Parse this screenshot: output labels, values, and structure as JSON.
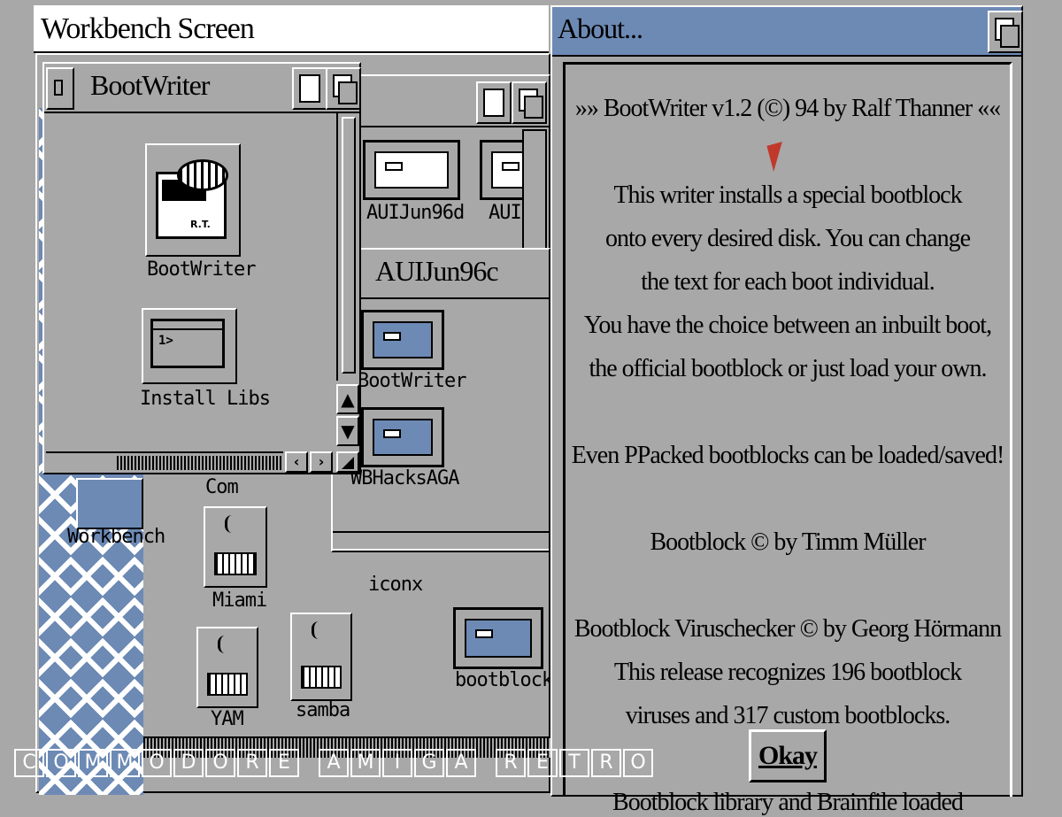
{
  "screen": {
    "title": "Workbench Screen"
  },
  "windows": {
    "bootwriter": {
      "title": "BootWriter",
      "icons": [
        {
          "label": "BootWriter",
          "badge": "R.T."
        },
        {
          "label": "Install Libs",
          "prompt": "1>"
        }
      ]
    },
    "back_drawer": {
      "icons": [
        "AUIJun96d",
        "AUI"
      ]
    },
    "auijun96c": {
      "title": "AUIJun96c",
      "icons": [
        "BootWriter",
        "WBHacksAGA",
        "iconx"
      ]
    },
    "workbench": {
      "icons": [
        "Workbench",
        "Miami",
        "YAM",
        "samba",
        "bootblock"
      ],
      "partial_label": "Com"
    }
  },
  "about": {
    "title": "About...",
    "lines": [
      "»» BootWriter v1.2 (©) 94 by Ralf Thanner ««",
      "This writer installs a special bootblock",
      "onto every desired disk.  You can change",
      "the text for each boot individual.",
      "You have the choice between an inbuilt boot,",
      "the official bootblock or just load your own.",
      "Even PPacked bootblocks can be loaded/saved!",
      "Bootblock  © by Timm Müller",
      "Bootblock Viruschecker  © by Georg Hörmann",
      "This release recognizes 196 bootblock",
      "viruses and 317 custom bootblocks.",
      "Bootblock library and Brainfile loaded"
    ],
    "okay": "Okay"
  },
  "watermark": [
    "C",
    "O",
    "M",
    "M",
    "O",
    "D",
    "O",
    "R",
    "E",
    " ",
    "A",
    "M",
    "I",
    "G",
    "A",
    " ",
    "R",
    "E",
    "T",
    "R",
    "O"
  ],
  "colors": {
    "bg": "#a8a8a8",
    "accent": "#6d8ab5",
    "white": "#ffffff",
    "black": "#000000"
  }
}
